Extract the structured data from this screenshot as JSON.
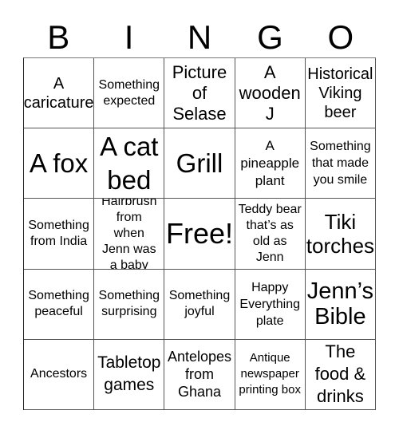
{
  "header": {
    "letters": [
      "B",
      "I",
      "N",
      "G",
      "O"
    ]
  },
  "grid": {
    "rows": [
      [
        "A caricature",
        "Something expected",
        "Picture of Selase",
        "A wooden J",
        "Historical Viking beer"
      ],
      [
        "A fox",
        "A cat bed",
        "Grill",
        "A pineapple plant",
        "Something that made you smile"
      ],
      [
        "Something from India",
        "Hairbrush from when Jenn was a baby",
        "Free!",
        "Teddy bear that’s as old as Jenn",
        "Tiki torches"
      ],
      [
        "Something peaceful",
        "Something surprising",
        "Something joyful",
        "Happy Everything plate",
        "Jenn’s Bible"
      ],
      [
        "Ancestors",
        "Tabletop games",
        "Antelopes from Ghana",
        "Antique newspaper printing box",
        "The food & drinks"
      ]
    ]
  }
}
